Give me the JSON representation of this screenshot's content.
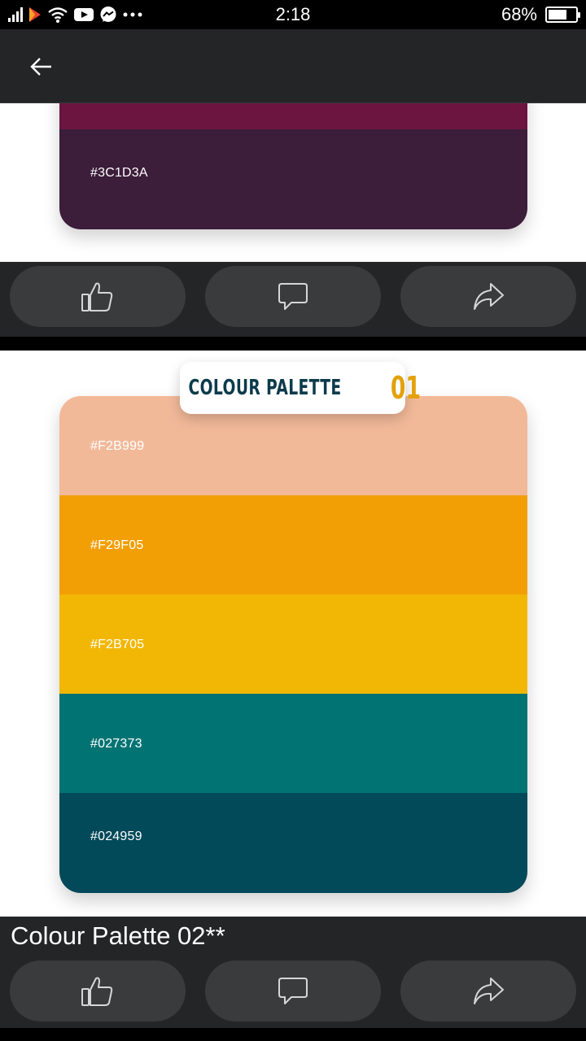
{
  "status_bar": {
    "time": "2:18",
    "battery": "68%",
    "battery_level": 0.68
  },
  "app_bar": {
    "back_icon": "arrow-left-icon"
  },
  "post1": {
    "swatches": [
      {
        "hex": "#6B1540",
        "label": ""
      },
      {
        "hex": "#3C1D3A",
        "label": "#3C1D3A"
      }
    ]
  },
  "post2": {
    "badge_text": "COLOUR PALETTE",
    "badge_number": "01",
    "caption": "Colour Palette 02**",
    "swatches": [
      {
        "hex": "#F2B999",
        "label": "#F2B999"
      },
      {
        "hex": "#F29F05",
        "label": "#F29F05"
      },
      {
        "hex": "#F2B705",
        "label": "#F2B705"
      },
      {
        "hex": "#027373",
        "label": "#027373"
      },
      {
        "hex": "#024959",
        "label": "#024959"
      }
    ]
  },
  "actions": {
    "like_icon": "thumbs-up-icon",
    "comment_icon": "comment-icon",
    "share_icon": "share-icon"
  },
  "colors": {
    "app_bar": "#242527",
    "button_bg": "#3A3B3D",
    "badge_text": "#0C3B4B",
    "badge_number": "#E4A10A"
  }
}
